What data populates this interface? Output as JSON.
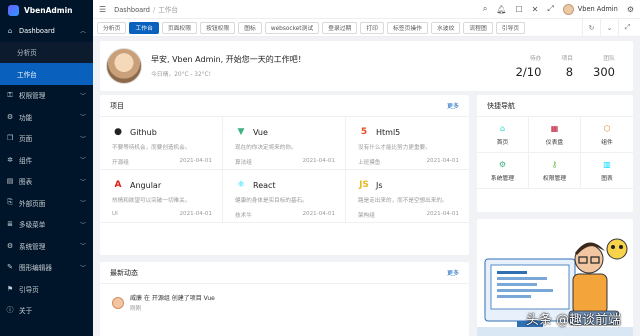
{
  "app": {
    "title": "VbenAdmin"
  },
  "sidebar": {
    "items": [
      {
        "label": "Dashboard",
        "icon": "home-icon",
        "glyph": "⌂",
        "open": true
      },
      {
        "label": "分析页",
        "sub": true
      },
      {
        "label": "工作台",
        "sub": true,
        "active": true
      },
      {
        "label": "权限管理",
        "icon": "key-icon",
        "glyph": "⚿"
      },
      {
        "label": "功能",
        "icon": "tool-icon",
        "glyph": "⚙"
      },
      {
        "label": "页面",
        "icon": "page-icon",
        "glyph": "❐"
      },
      {
        "label": "组件",
        "icon": "component-icon",
        "glyph": "✲"
      },
      {
        "label": "图表",
        "icon": "chart-icon",
        "glyph": "▤"
      },
      {
        "label": "外部页面",
        "icon": "link-icon",
        "glyph": "⎘"
      },
      {
        "label": "多级菜单",
        "icon": "menu-icon",
        "glyph": "≣"
      },
      {
        "label": "系统管理",
        "icon": "system-icon",
        "glyph": "⚙"
      },
      {
        "label": "图形编辑器",
        "icon": "editor-icon",
        "glyph": "✎"
      },
      {
        "label": "引导页",
        "icon": "guide-icon",
        "glyph": "⚑"
      },
      {
        "label": "关于",
        "icon": "info-icon",
        "glyph": "ⓘ"
      }
    ]
  },
  "header": {
    "breadcrumb": [
      "Dashboard",
      "工作台"
    ],
    "user": "Vben Admin"
  },
  "tabs": [
    "分析页",
    "工作台",
    "页面权限",
    "按钮权限",
    "图标",
    "websocket测试",
    "登录过期",
    "打印",
    "标签页操作",
    "水波纹",
    "流程图",
    "引导页"
  ],
  "welcome": {
    "greeting": "早安, Vben Admin, 开始您一天的工作吧！",
    "weather": "今日晴，20°C - 32°C!",
    "stats": [
      {
        "label": "待办",
        "value": "2/10"
      },
      {
        "label": "项目",
        "value": "8"
      },
      {
        "label": "团队",
        "value": "300"
      }
    ]
  },
  "projects": {
    "title": "项目",
    "more": "更多",
    "items": [
      {
        "name": "Github",
        "icon": "github-icon",
        "glyph": "●",
        "color": "#222222",
        "desc": "不要等待机会，而要创造机会。",
        "group": "开源组",
        "date": "2021-04-01"
      },
      {
        "name": "Vue",
        "icon": "vue-icon",
        "glyph": "▼",
        "color": "#3fb27f",
        "desc": "现在的你决定将来的你。",
        "group": "算法组",
        "date": "2021-04-01"
      },
      {
        "name": "Html5",
        "icon": "html5-icon",
        "glyph": "5",
        "color": "#e34c26",
        "desc": "没有什么才能比努力更重要。",
        "group": "上班摸鱼",
        "date": "2021-04-01"
      },
      {
        "name": "Angular",
        "icon": "angular-icon",
        "glyph": "A",
        "color": "#dd1b16",
        "desc": "热情和欲望可以突破一切难关。",
        "group": "UI",
        "date": "2021-04-01"
      },
      {
        "name": "React",
        "icon": "react-icon",
        "glyph": "⚛",
        "color": "#00d8ff",
        "desc": "健康的身体是实目标的基石。",
        "group": "技术牛",
        "date": "2021-04-01"
      },
      {
        "name": "Js",
        "icon": "js-icon",
        "glyph": "JS",
        "color": "#e8b923",
        "desc": "路是走出来的，而不是空想出来的。",
        "group": "架构组",
        "date": "2021-04-01"
      }
    ]
  },
  "activity": {
    "title": "最新动态",
    "more": "更多",
    "items": [
      {
        "text": "威廉 在 开源组 创建了项目 Vue",
        "time": "刚刚"
      }
    ]
  },
  "quicknav": {
    "title": "快捷导航",
    "items": [
      {
        "label": "首页",
        "icon": "home-icon",
        "glyph": "⌂",
        "color": "#1fdaca"
      },
      {
        "label": "仪表盘",
        "icon": "dashboard-icon",
        "glyph": "▦",
        "color": "#bf0c2c"
      },
      {
        "label": "组件",
        "icon": "component-icon",
        "glyph": "⬡",
        "color": "#e18525"
      },
      {
        "label": "系统管理",
        "icon": "setting-icon",
        "glyph": "⚙",
        "color": "#3fb27f"
      },
      {
        "label": "权限管理",
        "icon": "key-icon",
        "glyph": "⚷",
        "color": "#4daf1bc9"
      },
      {
        "label": "图表",
        "icon": "chart-icon",
        "glyph": "▥",
        "color": "#00d8ff"
      }
    ]
  },
  "watermark": "头条 @趣谈前端"
}
